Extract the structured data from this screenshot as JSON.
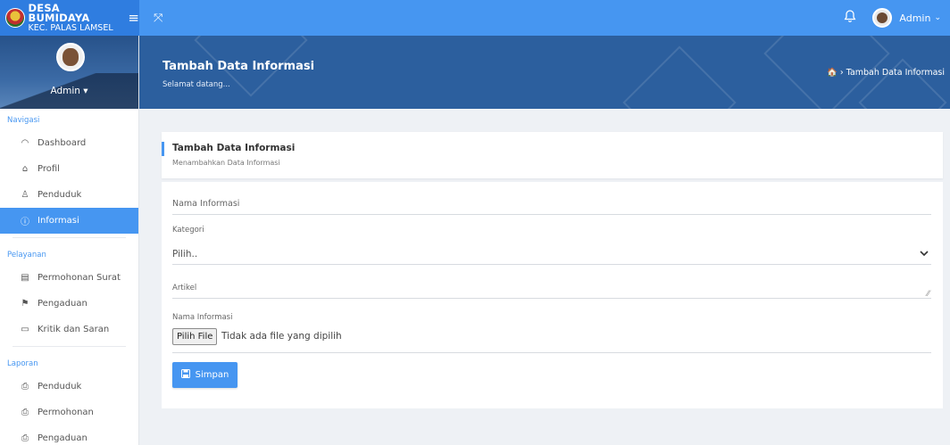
{
  "topbar": {
    "brand_name": "DESA BUMIDAYA",
    "brand_sub": "KEC. PALAS LAMSEL",
    "menu_icon": "≡",
    "expand_icon": "⤧",
    "bell_icon": "bell-icon",
    "user_name": "Admin",
    "caret": "⌄"
  },
  "sidebar": {
    "profile_name": "Admin ▾",
    "sections": [
      {
        "title": "Navigasi",
        "items": [
          {
            "label": "Dashboard",
            "icon": "dashboard-icon",
            "glyph": "◠"
          },
          {
            "label": "Profil",
            "icon": "home-icon",
            "glyph": "⌂"
          },
          {
            "label": "Penduduk",
            "icon": "user-icon",
            "glyph": "♙"
          },
          {
            "label": "Informasi",
            "icon": "info-icon",
            "glyph": "ⓘ",
            "active": true
          }
        ]
      },
      {
        "title": "Pelayanan",
        "items": [
          {
            "label": "Permohonan Surat",
            "icon": "document-icon",
            "glyph": "▤"
          },
          {
            "label": "Pengaduan",
            "icon": "flag-icon",
            "glyph": "⚑"
          },
          {
            "label": "Kritik dan Saran",
            "icon": "chat-icon",
            "glyph": "▭"
          }
        ]
      },
      {
        "title": "Laporan",
        "items": [
          {
            "label": "Penduduk",
            "icon": "print-icon",
            "glyph": "⎙"
          },
          {
            "label": "Permohonan",
            "icon": "print-icon",
            "glyph": "⎙"
          },
          {
            "label": "Pengaduan",
            "icon": "print-icon",
            "glyph": "⎙"
          }
        ]
      }
    ]
  },
  "banner": {
    "title": "Tambah Data Informasi",
    "subtitle": "Selamat datang...",
    "breadcrumb": "🏠 › Tambah Data Informasi"
  },
  "card": {
    "title": "Tambah Data Informasi",
    "subtitle": "Menambahkan Data Informasi"
  },
  "form": {
    "nama_label": "Nama Informasi",
    "kategori_label": "Kategori",
    "kategori_value": "Pilih..",
    "artikel_label": "Artikel",
    "file_label": "Nama Informasi",
    "file_button": "Pilih File",
    "file_status": "Tidak ada file yang dipilih",
    "submit_label": "Simpan"
  },
  "colors": {
    "primary": "#4696f1",
    "banner": "#2c5f9e"
  }
}
